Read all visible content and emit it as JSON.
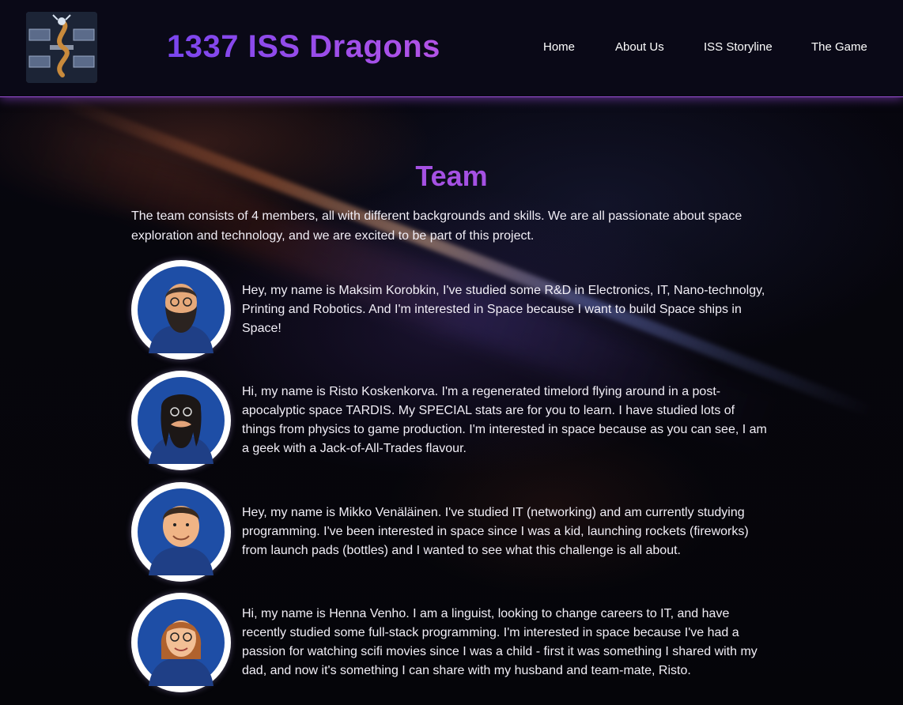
{
  "header": {
    "site_title": "1337 ISS Dragons",
    "nav": [
      "Home",
      "About Us",
      "ISS Storyline",
      "The Game"
    ]
  },
  "main": {
    "heading": "Team",
    "intro": "The team consists of 4 members, all with different backgrounds and skills. We are all passionate about space exploration and technology, and we are excited to be part of this project.",
    "members": [
      {
        "bio": "Hey, my name is Maksim Korobkin, I've studied some R&D in Electronics, IT, Nano-technolgy, Printing and Robotics. And I'm interested in Space because I want to build Space ships in Space!"
      },
      {
        "bio": "Hi, my name is Risto Koskenkorva. I'm a regenerated timelord flying around in a post-apocalyptic space TARDIS. My SPECIAL stats are for you to learn. I have studied lots of things from physics to game production. I'm interested in space because as you can see, I am a geek with a Jack-of-All-Trades flavour."
      },
      {
        "bio": "Hey, my name is Mikko Venäläinen. I've studied IT (networking) and am currently studying programming. I've been interested in space since I was a kid, launching rockets (fireworks) from launch pads (bottles) and I wanted to see what this challenge is all about."
      },
      {
        "bio": "Hi, my name is Henna Venho. I am a linguist, looking to change careers to IT, and have recently studied some full-stack programming. I'm interested in space because I've had a passion for watching scifi movies since I was a child - first it was something I shared with my dad, and now it's something I can share with my husband and team-mate, Risto."
      }
    ]
  }
}
